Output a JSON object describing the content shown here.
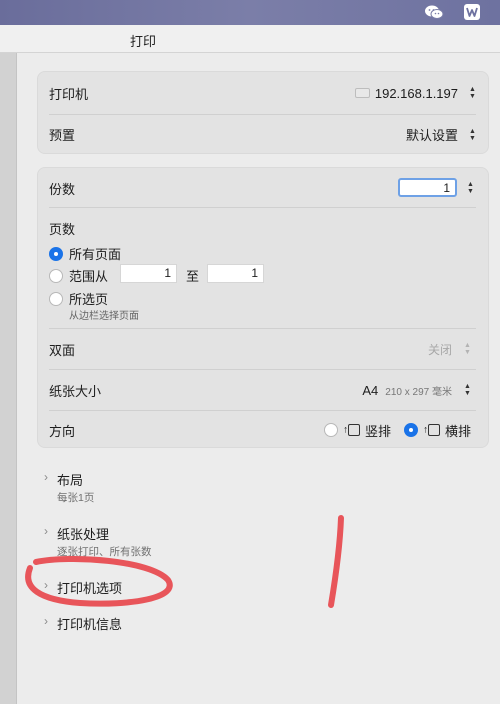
{
  "title": "打印",
  "menubar": {
    "wechat_icon": "wechat-icon",
    "wps_icon": "wps-icon"
  },
  "printer": {
    "label": "打印机",
    "value": "192.168.1.197"
  },
  "preset": {
    "label": "预置",
    "value": "默认设置"
  },
  "copies": {
    "label": "份数",
    "value": "1"
  },
  "pages": {
    "label": "页数",
    "all_label": "所有页面",
    "range_label": "范围从",
    "range_from": "1",
    "range_to_label": "至",
    "range_to": "1",
    "selection_label": "所选页",
    "selection_hint": "从边栏选择页面",
    "selected": "all"
  },
  "duplex": {
    "label": "双面",
    "value": "关闭"
  },
  "paper": {
    "label": "纸张大小",
    "value": "A4",
    "dims": "210 x 297 毫米"
  },
  "orientation": {
    "label": "方向",
    "portrait": "竖排",
    "landscape": "横排",
    "selected": "landscape"
  },
  "sections": [
    {
      "title": "布局",
      "subtitle": "每张1页"
    },
    {
      "title": "纸张处理",
      "subtitle": "逐张打印、所有张数"
    },
    {
      "title": "打印机选项",
      "subtitle": ""
    },
    {
      "title": "打印机信息",
      "subtitle": ""
    }
  ],
  "annotation_color": "#e8555a",
  "accent": "#1a73e8"
}
